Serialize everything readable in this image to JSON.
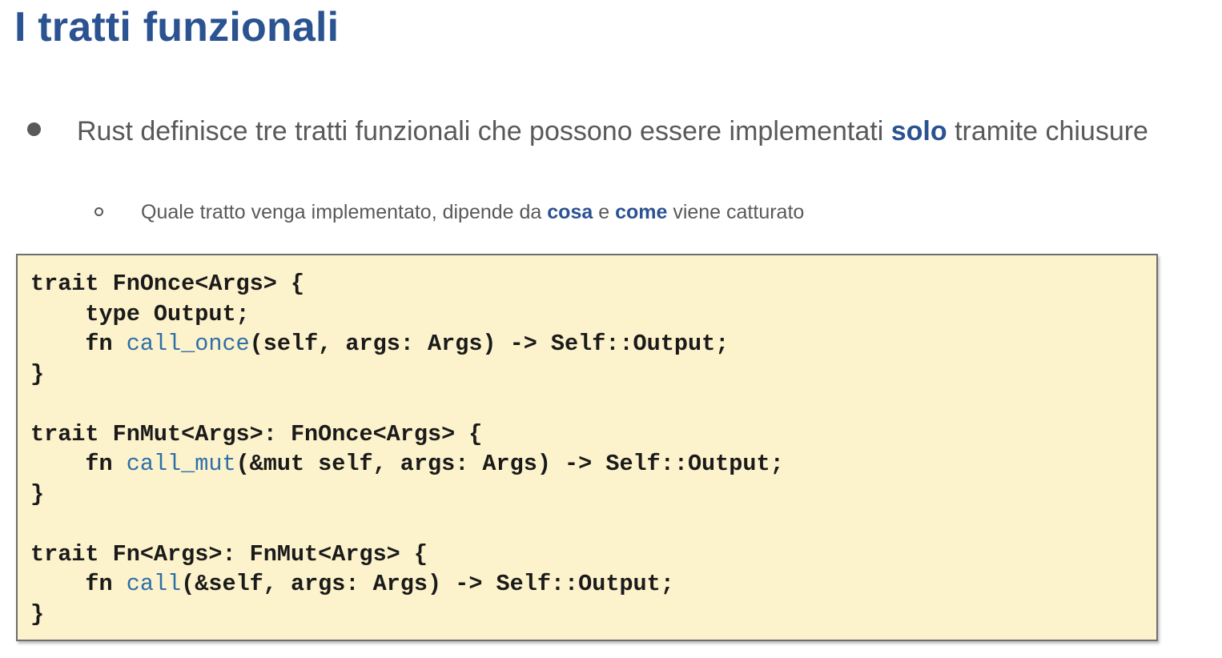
{
  "title": "I tratti funzionali",
  "bullet": {
    "text_before": "Rust definisce tre tratti funzionali che possono essere implementati ",
    "emphasis": "solo",
    "text_after": " tramite chiusure"
  },
  "sub_bullet": {
    "text_1": "Quale tratto venga implementato, dipende da ",
    "emphasis_1": "cosa",
    "text_2": " e ",
    "emphasis_2": "come",
    "text_3": " viene catturato"
  },
  "code": {
    "fnonce": {
      "line1": "trait FnOnce<Args> {",
      "line2": "    type Output;",
      "line3_kw": "    fn ",
      "line3_name": "call_once",
      "line3_rest": "(self, args: Args) -> Self::Output;",
      "line4": "}"
    },
    "fnmut": {
      "line1": "trait FnMut<Args>: FnOnce<Args> {",
      "line2_kw": "    fn ",
      "line2_name": "call_mut",
      "line2_rest": "(&mut self, args: Args) -> Self::Output;",
      "line3": "}"
    },
    "fn": {
      "line1": "trait Fn<Args>: FnMut<Args> {",
      "line2_kw": "    fn ",
      "line2_name": "call",
      "line2_rest": "(&self, args: Args) -> Self::Output;",
      "line3": "}"
    }
  },
  "colors": {
    "title": "#2b5291",
    "emphasis": "#2b5291",
    "body_text": "#595959",
    "code_background": "#fcf2cc",
    "code_function_name": "#2e6fa8"
  }
}
